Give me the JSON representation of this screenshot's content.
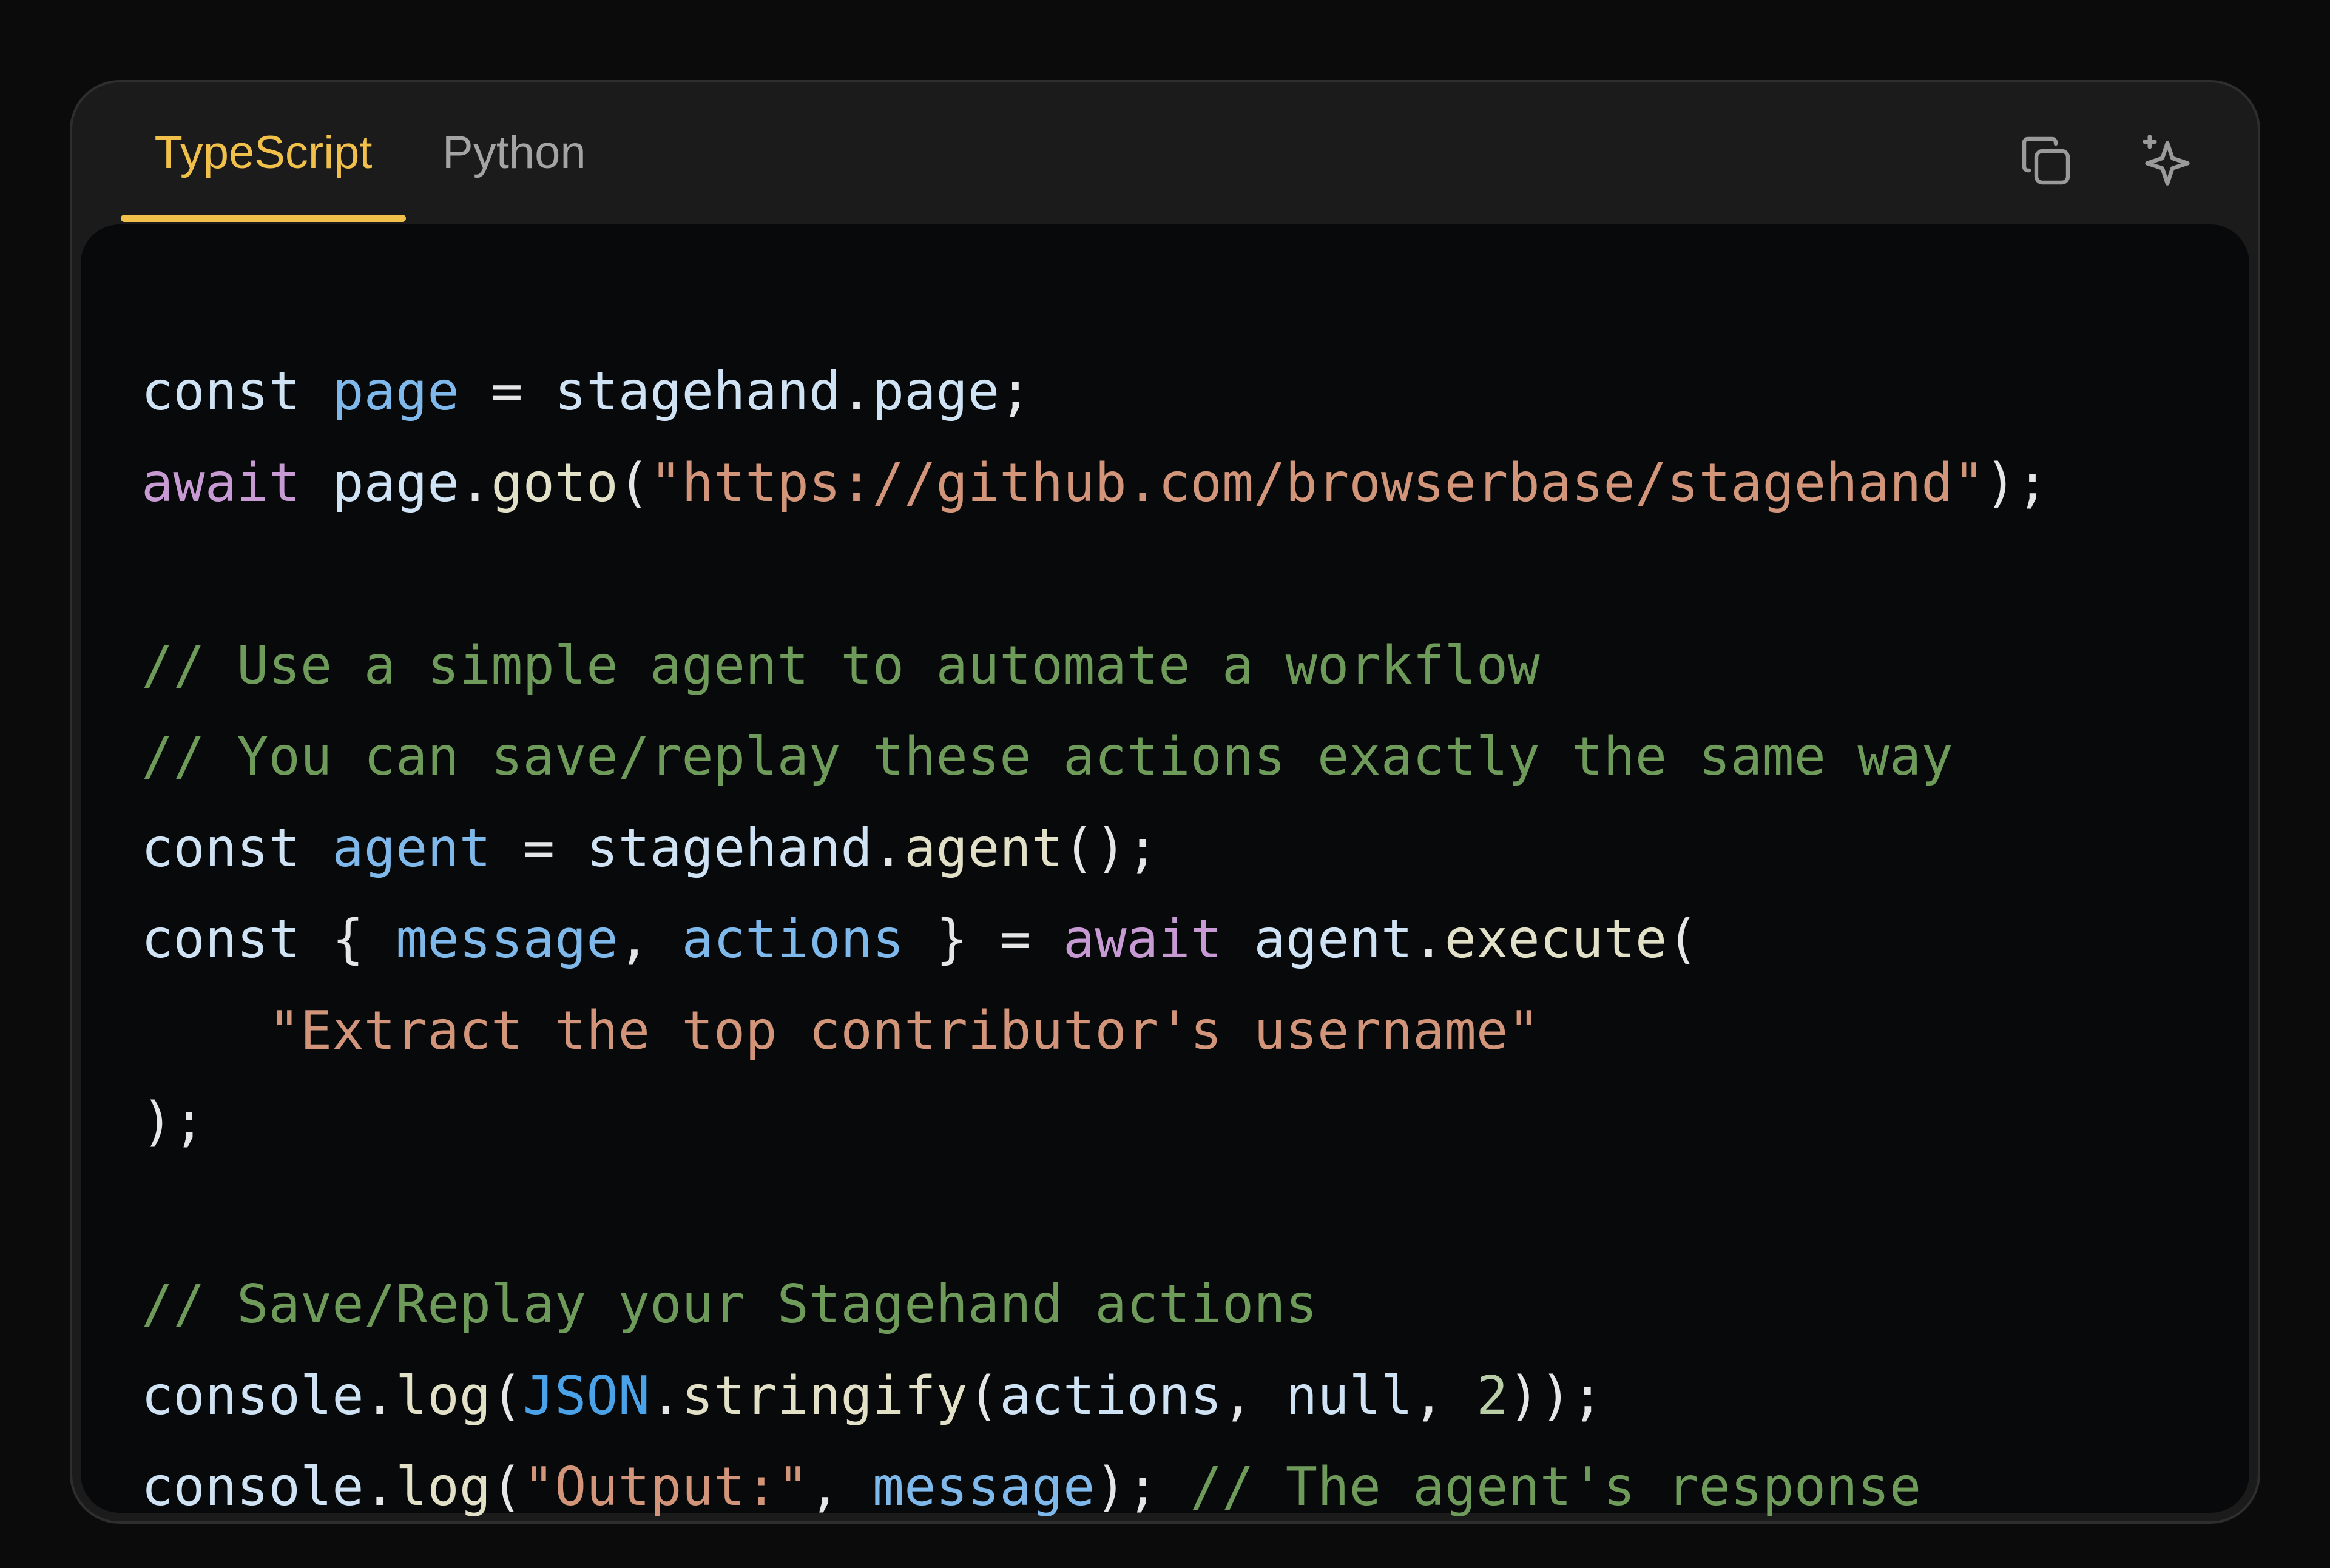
{
  "tabs": [
    {
      "label": "TypeScript",
      "active": true
    },
    {
      "label": "Python",
      "active": false
    }
  ],
  "icons": {
    "copy": "copy-icon",
    "ai": "sparkle-icon"
  },
  "colors": {
    "accent": "#f0c04a",
    "background": "#0b0b0b",
    "code_bg": "#08090b"
  },
  "code": {
    "l1": {
      "a": "const",
      "b": "page",
      "c": " = ",
      "d": "stagehand",
      "e": ".",
      "f": "page",
      "g": ";"
    },
    "l2": {
      "a": "await",
      "b": "page",
      "c": ".",
      "d": "goto",
      "e": "(",
      "f": "\"https://github.com/browserbase/stagehand\"",
      "g": ");"
    },
    "l4": "// Use a simple agent to automate a workflow",
    "l5": "// You can save/replay these actions exactly the same way",
    "l6": {
      "a": "const",
      "b": "agent",
      "c": " = ",
      "d": "stagehand",
      "e": ".",
      "f": "agent",
      "g": "();"
    },
    "l7": {
      "a": "const",
      "b": "{ ",
      "c": "message",
      "d": ", ",
      "e": "actions",
      "f": " } = ",
      "g": "await",
      "h": "agent",
      "i": ".",
      "j": "execute",
      "k": "("
    },
    "l8": "\"Extract the top contributor's username\"",
    "l9": ");",
    "l11": "// Save/Replay your Stagehand actions",
    "l12": {
      "a": "console",
      "b": ".",
      "c": "log",
      "d": "(",
      "e": "JSON",
      "f": ".",
      "g": "stringify",
      "h": "(",
      "i": "actions",
      "j": ", ",
      "k": "null",
      "l": ", ",
      "m": "2",
      "n": "));"
    },
    "l13": {
      "a": "console",
      "b": ".",
      "c": "log",
      "d": "(",
      "e": "\"Output:\"",
      "f": ", ",
      "g": "message",
      "h": ");",
      "i": "// The agent's response"
    }
  }
}
